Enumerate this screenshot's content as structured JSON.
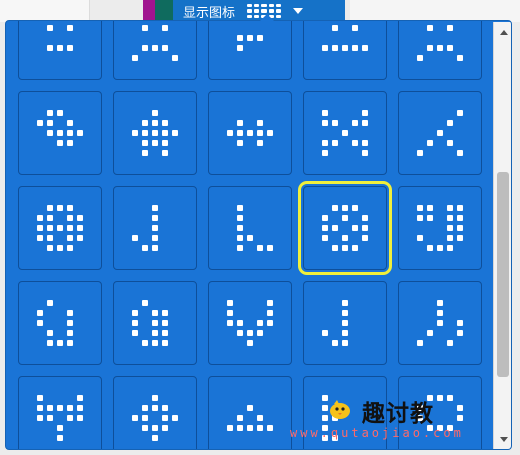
{
  "header": {
    "label": "显示图标",
    "dropdown_icon": "led-grid-icon"
  },
  "colors": {
    "panel_bg": "#1a74d6",
    "tile_border": "#0e4f9a",
    "selection": "#f0f03c",
    "header_bg": "#1572c8",
    "accent_magenta": "#a0148f",
    "accent_teal": "#0f6b5e"
  },
  "icons": [
    {
      "name": "icon-1",
      "pattern": [
        "00000",
        "01010",
        "00000",
        "01110",
        "00000"
      ]
    },
    {
      "name": "icon-2",
      "pattern": [
        "00000",
        "01010",
        "00000",
        "01110",
        "10001"
      ]
    },
    {
      "name": "icon-3",
      "pattern": [
        "00000",
        "00000",
        "01110",
        "01000",
        "00000"
      ]
    },
    {
      "name": "icon-4",
      "pattern": [
        "00000",
        "01010",
        "00000",
        "11111",
        "00000"
      ]
    },
    {
      "name": "icon-5",
      "pattern": [
        "00000",
        "01010",
        "00000",
        "01110",
        "10001"
      ]
    },
    {
      "name": "icon-6",
      "pattern": [
        "01100",
        "11010",
        "01111",
        "00110",
        "00000"
      ]
    },
    {
      "name": "icon-7",
      "pattern": [
        "00100",
        "01110",
        "11111",
        "01110",
        "01010"
      ]
    },
    {
      "name": "icon-8",
      "pattern": [
        "00000",
        "01010",
        "11111",
        "01010",
        "00000"
      ]
    },
    {
      "name": "icon-9",
      "pattern": [
        "10001",
        "11011",
        "00100",
        "11011",
        "10001"
      ]
    },
    {
      "name": "icon-10",
      "pattern": [
        "00001",
        "00010",
        "00100",
        "01010",
        "10001"
      ]
    },
    {
      "name": "icon-11",
      "pattern": [
        "01110",
        "11011",
        "11111",
        "11011",
        "01110"
      ]
    },
    {
      "name": "icon-12",
      "pattern": [
        "00100",
        "00100",
        "00100",
        "10100",
        "01100"
      ]
    },
    {
      "name": "icon-13",
      "pattern": [
        "01000",
        "01000",
        "01000",
        "01100",
        "01011"
      ]
    },
    {
      "name": "icon-14",
      "pattern": [
        "01110",
        "10101",
        "11011",
        "10101",
        "01110"
      ]
    },
    {
      "name": "icon-15",
      "pattern": [
        "11011",
        "11011",
        "00011",
        "10011",
        "01110"
      ]
    },
    {
      "name": "icon-16",
      "pattern": [
        "01000",
        "10010",
        "10010",
        "01010",
        "01110"
      ]
    },
    {
      "name": "icon-17",
      "pattern": [
        "01000",
        "10110",
        "10110",
        "10110",
        "01110"
      ]
    },
    {
      "name": "icon-18",
      "pattern": [
        "10001",
        "10001",
        "11011",
        "01110",
        "00100"
      ]
    },
    {
      "name": "icon-19",
      "pattern": [
        "00100",
        "00100",
        "00100",
        "10100",
        "01100"
      ]
    },
    {
      "name": "icon-20",
      "pattern": [
        "00100",
        "00100",
        "00101",
        "01001",
        "10010"
      ]
    },
    {
      "name": "icon-21",
      "pattern": [
        "10001",
        "11111",
        "11011",
        "00100",
        "00100"
      ]
    },
    {
      "name": "icon-22",
      "pattern": [
        "00100",
        "01110",
        "11011",
        "01110",
        "00100"
      ]
    },
    {
      "name": "icon-23",
      "pattern": [
        "00000",
        "00100",
        "01010",
        "11111",
        "00000"
      ]
    },
    {
      "name": "icon-24",
      "pattern": [
        "10000",
        "10000",
        "11000",
        "10000",
        "11000"
      ]
    },
    {
      "name": "icon-25",
      "pattern": [
        "01110",
        "10001",
        "10001",
        "01110",
        "00000"
      ]
    }
  ],
  "selected_index": 13,
  "watermark": {
    "title": "趣讨教",
    "url": "www.qutaojiao.com",
    "logo_icon": "chick-mascot-icon"
  }
}
